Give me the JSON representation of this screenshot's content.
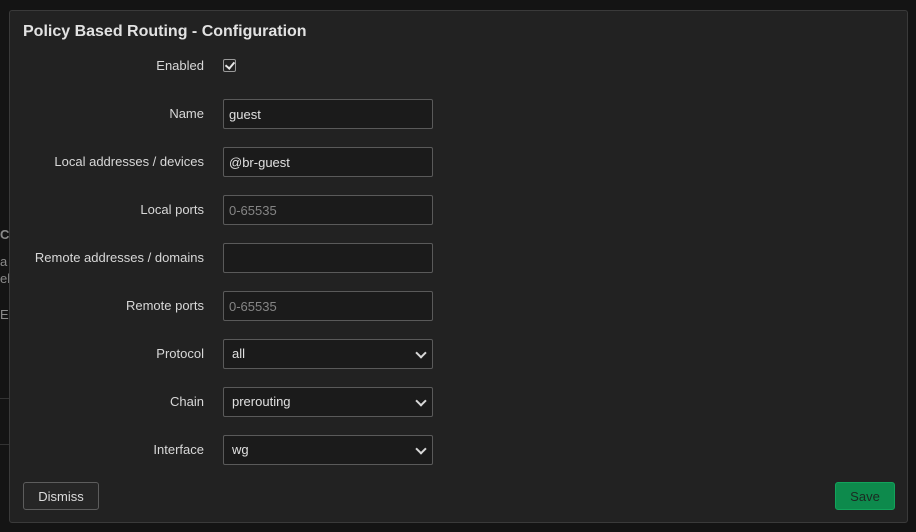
{
  "background_fragments": [
    "C",
    "a",
    "el",
    "E"
  ],
  "modal": {
    "title": "Policy Based Routing - Configuration",
    "fields": {
      "enabled": {
        "label": "Enabled",
        "checked": true
      },
      "name": {
        "label": "Name",
        "value": "guest",
        "placeholder": ""
      },
      "local_addresses": {
        "label": "Local addresses / devices",
        "value": "@br-guest",
        "placeholder": ""
      },
      "local_ports": {
        "label": "Local ports",
        "value": "",
        "placeholder": "0-65535"
      },
      "remote_addresses": {
        "label": "Remote addresses / domains",
        "value": "",
        "placeholder": ""
      },
      "remote_ports": {
        "label": "Remote ports",
        "value": "",
        "placeholder": "0-65535"
      },
      "protocol": {
        "label": "Protocol",
        "selected": "all"
      },
      "chain": {
        "label": "Chain",
        "selected": "prerouting"
      },
      "interface": {
        "label": "Interface",
        "selected": "wg"
      }
    },
    "buttons": {
      "dismiss": "Dismiss",
      "save": "Save"
    }
  },
  "colors": {
    "background": "#141414",
    "modal_bg": "#222222",
    "save_button": "#0d8a4c"
  }
}
